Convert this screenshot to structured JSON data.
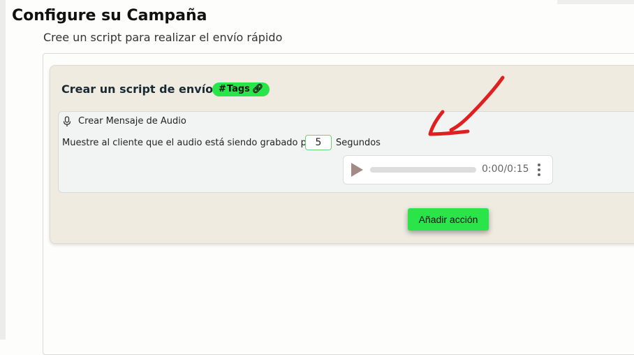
{
  "page": {
    "title": "Configure su Campaña",
    "subtitle": "Cree un script para realizar el envío rápido"
  },
  "script_card": {
    "title": "Crear un script de envío",
    "tags_badge": {
      "hash": "#",
      "label": "Tags",
      "icon": "link-icon"
    }
  },
  "audio_section": {
    "title": "Crear Mensaje de Audio",
    "icon": "microphone-icon",
    "record_text": "Muestre al cliente que el audio está siendo grabado por",
    "seconds_value": "5",
    "seconds_label": "Segundos",
    "player": {
      "time": "0:00/0:15",
      "progress": 0
    }
  },
  "actions": {
    "add_action_label": "Añadir acción"
  },
  "colors": {
    "accent_green": "#2ae54a",
    "annotation_red": "#e02020",
    "card_background": "#efebe1"
  }
}
